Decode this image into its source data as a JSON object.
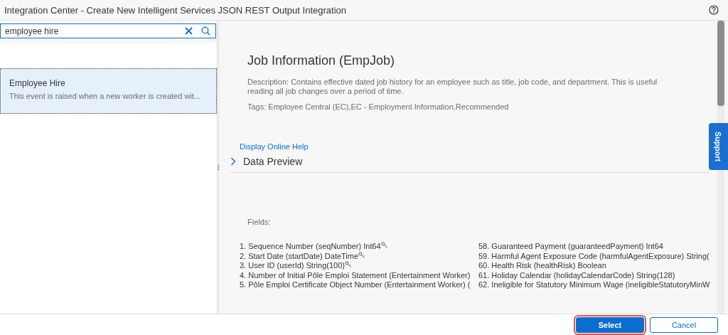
{
  "window": {
    "title": "Integration Center - Create New Intelligent Services JSON REST Output Integration"
  },
  "search": {
    "value": "employee hire"
  },
  "results": [
    {
      "title": "Employee Hire",
      "description": "This event is raised when a new worker is created wit...",
      "selected": true
    }
  ],
  "detail": {
    "title": "Job Information (EmpJob)",
    "description": "Description: Contains effective dated job history for an employee such as title, job code, and department. This is useful reading all job changes over a period of time.",
    "tags": "Tags: Employee Central (EC),EC - Employment Information,Recommended",
    "help_link": "Display Online Help",
    "section": {
      "label": "Data Preview",
      "expanded": false
    },
    "fields_label": "Fields:",
    "field_columns": [
      [
        {
          "text": "1. Sequence Number (seqNumber) Int64",
          "key": true
        },
        {
          "text": "2. Start Date (startDate) DateTime",
          "key": true
        },
        {
          "text": "3. User ID (userId) String(100)",
          "key": true
        },
        {
          "text": "4. Number of Initial Pôle Emploi Statement (Entertainment Worker)",
          "key": false
        },
        {
          "text": "5. Pôle Emploi Certificate Object Number (Entertainment Worker) (",
          "key": false
        }
      ],
      [
        {
          "text": "58. Guaranteed Payment (guaranteedPayment) Int64",
          "key": false
        },
        {
          "text": "59. Harmful Agent Exposure Code (harmfulAgentExposure) String(",
          "key": false
        },
        {
          "text": "60. Health Risk (healthRisk) Boolean",
          "key": false
        },
        {
          "text": "61. Holiday Calendar (holidayCalendarCode) String(128)",
          "key": false
        },
        {
          "text": "62. Ineligible for Statutory Minimum Wage (ineligibleStatutoryMinW",
          "key": false
        }
      ]
    ]
  },
  "support_tab": {
    "label": "Support"
  },
  "buttons": [
    {
      "label": "Select",
      "kind": "primary",
      "focused": true
    },
    {
      "label": "Cancel",
      "kind": "secondary",
      "focused": false
    }
  ]
}
